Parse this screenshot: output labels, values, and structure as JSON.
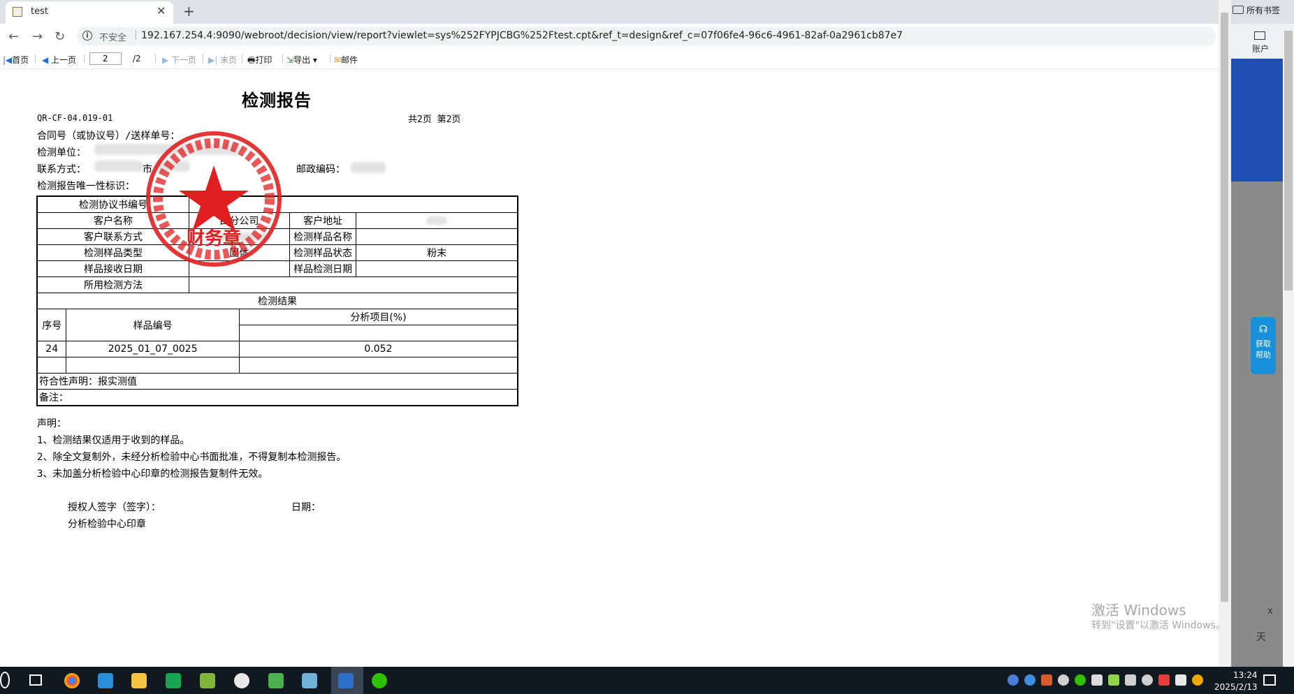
{
  "browser": {
    "tab_title": "test",
    "new_tab": "+",
    "tab_close": "✕",
    "bookmarks_label": "所有书签",
    "insecure_label": "不安全",
    "url": "192.167.254.4:9090/webroot/decision/view/report?viewlet=sys%252FYPJCBG%252Ftest.cpt&ref_t=design&ref_c=07f06fe4-96c6-4961-82af-0a2961cb87e7"
  },
  "toolbar": {
    "first": "首页",
    "prev": "上一页",
    "page_value": "2",
    "page_total": "/2",
    "next": "下一页",
    "last": "末页",
    "print": "打印",
    "export": "导出",
    "mail": "邮件"
  },
  "report": {
    "title": "检测报告",
    "doc_code": "QR-CF-04.019-01",
    "page_info": "共2页 第2页",
    "contract_label": "合同号（或协议号）/送样单号：",
    "unit_label": "检测单位：",
    "contact_label": "联系方式：",
    "contact_partial": "市",
    "postcode_label": "邮政编码：",
    "unique_id_label": "检测报告唯一性标识：",
    "table": {
      "agreement_no_label": "检测协议书编号",
      "customer_name_label": "客户名称",
      "customer_name_value": "西分公司",
      "customer_addr_label": "客户地址",
      "customer_contact_label": "客户联系方式",
      "sample_name_label": "检测样品名称",
      "sample_type_label": "检测样品类型",
      "sample_type_value": "固体",
      "sample_state_label": "检测样品状态",
      "sample_state_value": "粉末",
      "receive_date_label": "样品接收日期",
      "test_date_label": "样品检测日期",
      "method_label": "所用检测方法",
      "results_label": "检测结果",
      "col_no": "序号",
      "col_sample_no": "样品编号",
      "col_items": "分析项目(%)",
      "rows": [
        {
          "no": "24",
          "sample_no": "2025_01_07_0025",
          "value": "0.052"
        }
      ],
      "conformity": "符合性声明：报实测值",
      "remark": "备注："
    },
    "statement_title": "声明：",
    "statements": [
      "1、检测结果仅适用于收到的样品。",
      "2、除全文复制外，未经分析检验中心书面批准，不得复制本检测报告。",
      "3、未加盖分析检验中心印章的检测报告复制件无效。"
    ],
    "signer_label": "授权人签字（签字）：",
    "date_label": "日期：",
    "seal_label": "分析检验中心印章",
    "stamp_text": "财务章"
  },
  "side_panel": {
    "account_label": "账户",
    "help_label_1": "获取",
    "help_label_2": "帮助",
    "close_label": "x",
    "weather_label": "天"
  },
  "watermark": {
    "line1": "激活 Windows",
    "line2": "转到\"设置\"以激活 Windows。"
  },
  "taskbar": {
    "time": "13:24",
    "date": "2025/2/13"
  },
  "colors": {
    "stamp_red": "#e02020",
    "toolbar_blue": "#1e6fd9",
    "side_blue": "#1f4fb3",
    "help_blue": "#1590d9",
    "taskbar": "#101820"
  }
}
